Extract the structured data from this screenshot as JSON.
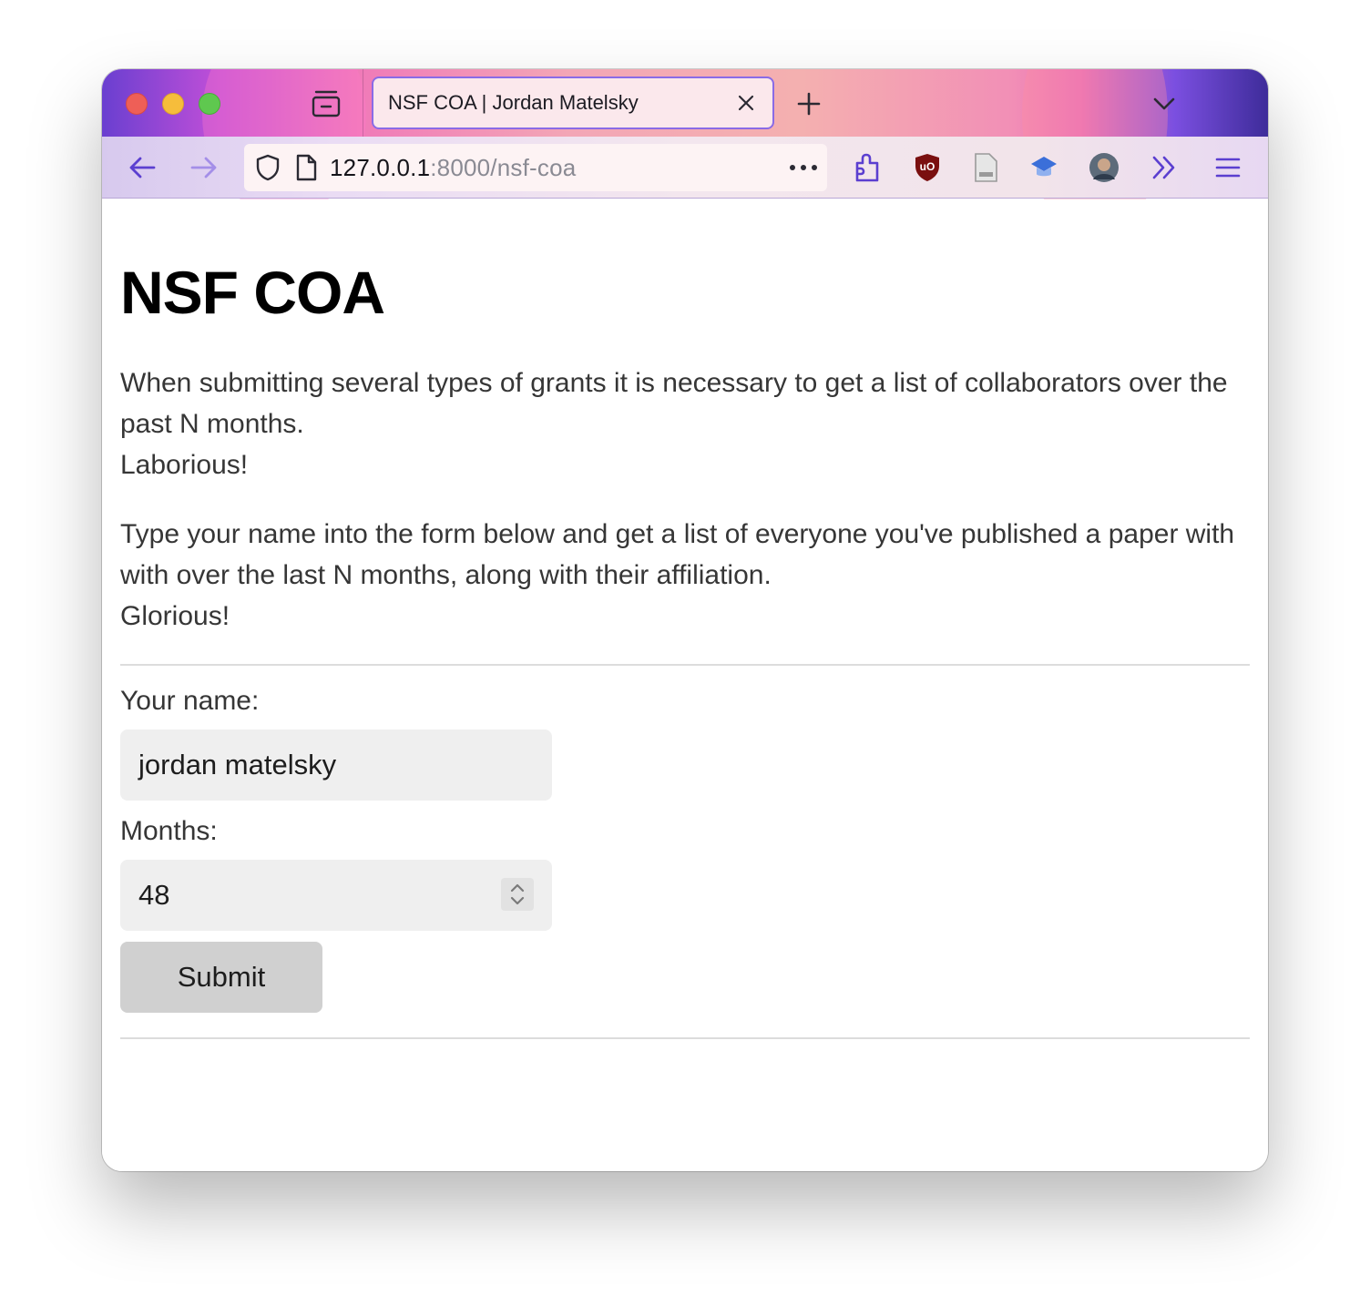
{
  "browser": {
    "tab_title": "NSF COA | Jordan Matelsky",
    "url_host": "127.0.0.1",
    "url_rest": ":8000/nsf-coa",
    "icons": {
      "tab_overview": "tab-overview-icon",
      "tab_close": "close-icon",
      "new_tab": "plus-icon",
      "tab_list": "chevron-down-icon",
      "back": "arrow-left-icon",
      "forward": "arrow-right-icon",
      "site_security": "shield-icon",
      "page": "page-icon",
      "more": "ellipsis-icon",
      "extensions": "puzzle-icon",
      "ublock": "ublock-shield-icon",
      "reader": "document-icon",
      "scholar": "graduation-cap-icon",
      "profile": "profile-avatar-icon",
      "overflow": "double-chevron-right-icon",
      "menu": "hamburger-menu-icon"
    }
  },
  "page": {
    "title": "NSF COA",
    "para1_line1": "When submitting several types of grants it is necessary to get a list of collaborators over the past N months.",
    "para1_line2": "Laborious!",
    "para2_line1": "Type your name into the form below and get a list of everyone you've published a paper with with over the last N months, along with their affiliation.",
    "para2_line2": "Glorious!",
    "form": {
      "name_label": "Your name:",
      "name_value": "jordan matelsky",
      "months_label": "Months:",
      "months_value": "48",
      "submit_label": "Submit"
    }
  },
  "colors": {
    "tab_border": "#8a6be6",
    "accent_icon": "#5b3fd0",
    "text": "#363636",
    "field_bg": "#efefef",
    "button_bg": "#d0d0d0"
  }
}
